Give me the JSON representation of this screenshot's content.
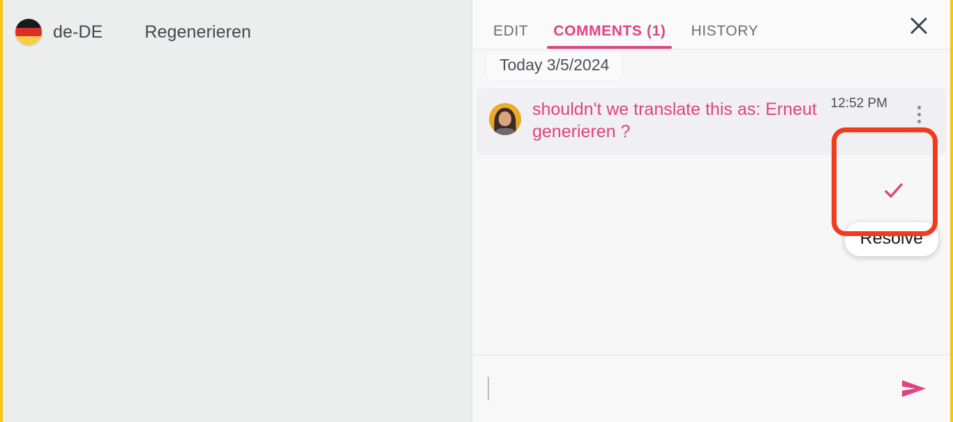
{
  "theme": {
    "accent_pink": "#e0437d",
    "annotation_red": "#f03b1e",
    "rail_gold": "#f5c518",
    "panel_bg": "#f7f7f8",
    "editor_bg": "#eceded"
  },
  "editor": {
    "locale_code": "de-DE",
    "flag_icon": "german-flag-icon",
    "source_text": "Regenerieren"
  },
  "tabs": [
    {
      "label": "EDIT",
      "active": false
    },
    {
      "label": "COMMENTS (1)",
      "active": true
    },
    {
      "label": "HISTORY",
      "active": false
    }
  ],
  "header": {
    "close_icon": "close-icon"
  },
  "thread": {
    "date_divider": "Today 3/5/2024",
    "comments": [
      {
        "author_avatar": "user-avatar",
        "text": "shouldn't we translate this as: Erneut generieren ?",
        "timestamp": "12:52 PM",
        "menu_icon": "more-vertical-icon"
      }
    ]
  },
  "actions": {
    "resolve_icon": "check-icon",
    "resolve_tooltip": "Resolve"
  },
  "composer": {
    "value": "",
    "placeholder": "",
    "send_icon": "send-icon"
  }
}
